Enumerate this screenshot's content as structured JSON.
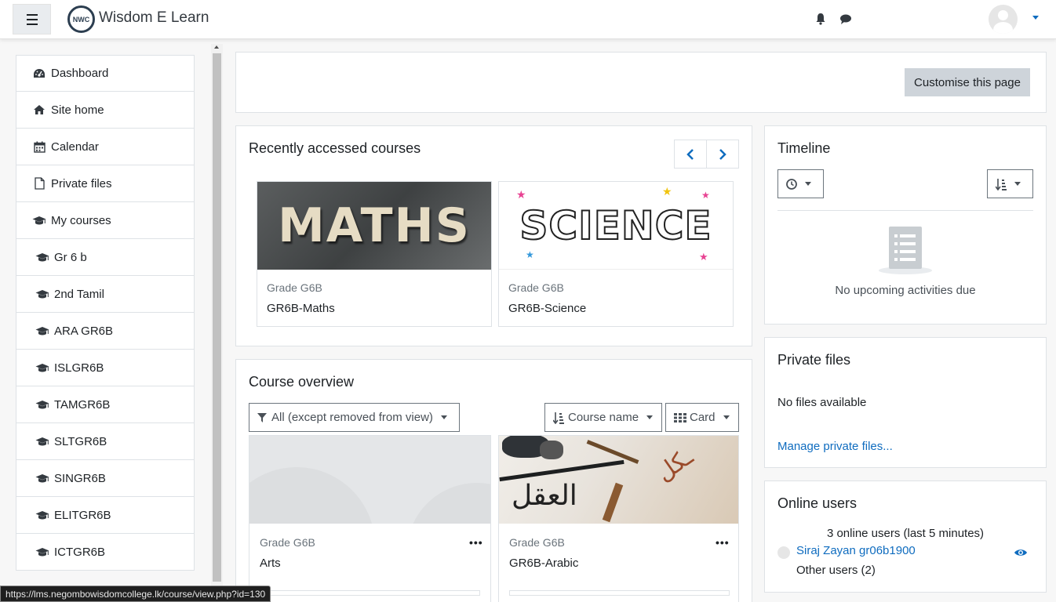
{
  "navbar": {
    "brand": "Wisdom E Learn",
    "logo_text": "NWC",
    "icons": [
      "menu-icon",
      "bell-icon",
      "chat-icon",
      "avatar",
      "caret-down-icon"
    ]
  },
  "drawer": {
    "items": [
      {
        "label": "Dashboard",
        "icon": "dashboard-icon"
      },
      {
        "label": "Site home",
        "icon": "home-icon"
      },
      {
        "label": "Calendar",
        "icon": "calendar-icon"
      },
      {
        "label": "Private files",
        "icon": "file-icon"
      },
      {
        "label": "My courses",
        "icon": "graduation-cap-icon"
      },
      {
        "label": "Gr 6 b",
        "icon": "graduation-cap-icon"
      },
      {
        "label": "2nd Tamil",
        "icon": "graduation-cap-icon"
      },
      {
        "label": "ARA GR6B",
        "icon": "graduation-cap-icon"
      },
      {
        "label": "ISLGR6B",
        "icon": "graduation-cap-icon"
      },
      {
        "label": "TAMGR6B",
        "icon": "graduation-cap-icon"
      },
      {
        "label": "SLTGR6B",
        "icon": "graduation-cap-icon"
      },
      {
        "label": "SINGR6B",
        "icon": "graduation-cap-icon"
      },
      {
        "label": "ELITGR6B",
        "icon": "graduation-cap-icon"
      },
      {
        "label": "ICTGR6B",
        "icon": "graduation-cap-icon"
      }
    ]
  },
  "header": {
    "customise_label": "Customise this page"
  },
  "recent": {
    "title": "Recently accessed courses",
    "courses": [
      {
        "category": "Grade G6B",
        "name": "GR6B-Maths",
        "image_text": "MATHS"
      },
      {
        "category": "Grade G6B",
        "name": "GR6B-Science",
        "image_text": "SCIENCE"
      }
    ]
  },
  "overview": {
    "title": "Course overview",
    "filter_label": "All (except removed from view)",
    "sort_label": "Course name",
    "view_label": "Card",
    "courses": [
      {
        "category": "Grade G6B",
        "name": "Arts"
      },
      {
        "category": "Grade G6B",
        "name": "GR6B-Arabic",
        "image_text": "العقل"
      }
    ]
  },
  "timeline": {
    "title": "Timeline",
    "empty_text": "No upcoming activities due"
  },
  "private_files": {
    "title": "Private files",
    "empty_text": "No files available",
    "manage_link": "Manage private files..."
  },
  "online_users": {
    "title": "Online users",
    "summary": "3 online users (last 5 minutes)",
    "user": "Siraj Zayan gr06b1900",
    "others": "Other users (2)"
  },
  "status_url": "https://lms.negombowisdomcollege.lk/course/view.php?id=130",
  "colors": {
    "link": "#0f6cbf",
    "page_bg": "#f7f7f7",
    "button_secondary": "#ced4da"
  }
}
